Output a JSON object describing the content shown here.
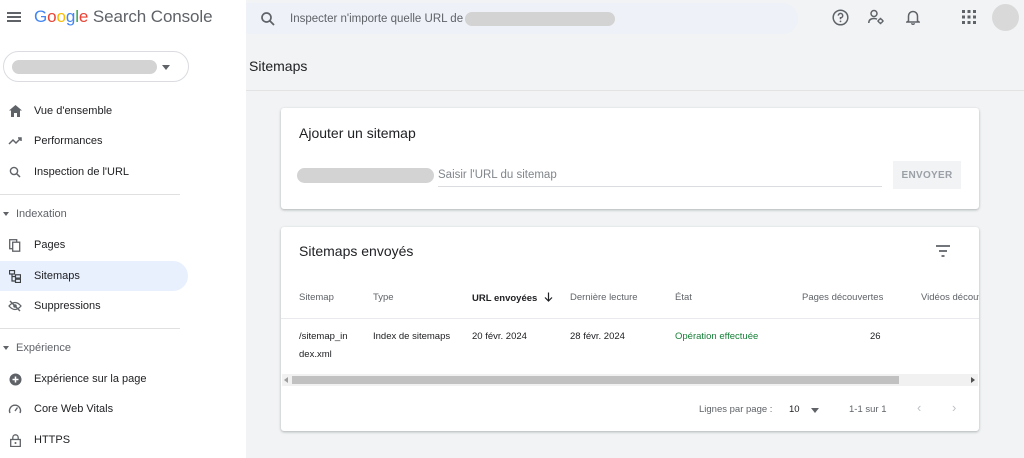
{
  "app": {
    "logo": {
      "google": [
        "G",
        "o",
        "o",
        "g",
        "l",
        "e"
      ],
      "product": "Search Console"
    },
    "search_placeholder": "Inspecter n'importe quelle URL de"
  },
  "sidebar": {
    "overview": "Vue d'ensemble",
    "performance": "Performances",
    "url_inspection": "Inspection de l'URL",
    "section_indexing": "Indexation",
    "pages": "Pages",
    "sitemaps": "Sitemaps",
    "removals": "Suppressions",
    "section_experience": "Expérience",
    "page_experience": "Expérience sur la page",
    "core_web_vitals": "Core Web Vitals",
    "https": "HTTPS"
  },
  "main": {
    "page_title": "Sitemaps",
    "add_card": {
      "title": "Ajouter un sitemap",
      "input_placeholder": "Saisir l'URL du sitemap",
      "submit_label": "ENVOYER"
    },
    "submitted_card": {
      "title": "Sitemaps envoyés",
      "columns": [
        "Sitemap",
        "Type",
        "URL envoyées",
        "Dernière lecture",
        "État",
        "Pages découvertes",
        "Vidéos découv"
      ],
      "rows": [
        {
          "sitemap_line1": "/sitemap_in",
          "sitemap_line2": "dex.xml",
          "type": "Index de sitemaps",
          "submitted": "20 févr. 2024",
          "last_read": "28 févr. 2024",
          "status": "Opération effectuée",
          "discovered_pages": "26"
        }
      ],
      "pagination": {
        "rows_per_page_label": "Lignes par page :",
        "rows_per_page_value": "10",
        "range": "1-1 sur 1"
      }
    }
  },
  "colors": {
    "accent_active": "#e8f0fe",
    "status_success": "#188038",
    "google_blue": "#4285f4",
    "google_red": "#ea4335",
    "google_yellow": "#fbbc05",
    "google_green": "#34a853"
  }
}
